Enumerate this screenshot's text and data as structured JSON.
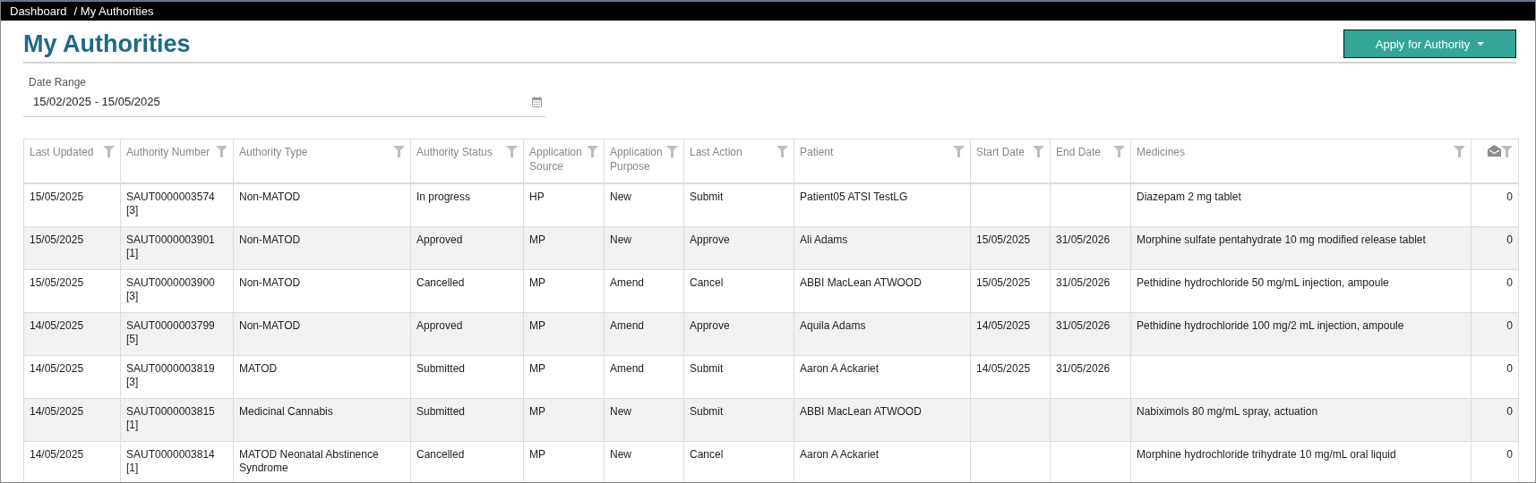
{
  "breadcrumb": [
    {
      "label": "Dashboard"
    },
    {
      "label": "/ My Authorities"
    }
  ],
  "title": "My Authorities",
  "apply_button": {
    "label": "Apply for Authority"
  },
  "date_range": {
    "label": "Date Range",
    "value": "15/02/2025 - 15/05/2025"
  },
  "table": {
    "columns": [
      {
        "label": "Last Updated"
      },
      {
        "label": "Authority Number"
      },
      {
        "label": "Authority Type"
      },
      {
        "label": "Authority Status"
      },
      {
        "label": "Application Source"
      },
      {
        "label": "Application Purpose"
      },
      {
        "label": "Last Action"
      },
      {
        "label": "Patient"
      },
      {
        "label": "Start Date"
      },
      {
        "label": "End Date"
      },
      {
        "label": "Medicines"
      },
      {
        "kind": "messages"
      }
    ],
    "rows": [
      {
        "last_updated": "15/05/2025",
        "authority_number": "SAUT0000003574",
        "version": "[3]",
        "authority_type": "Non-MATOD",
        "status": "In progress",
        "source": "HP",
        "purpose": "New",
        "last_action": "Submit",
        "patient": "Patient05 ATSI TestLG",
        "start_date": "",
        "end_date": "",
        "medicines": "Diazepam 2 mg tablet",
        "messages": "0"
      },
      {
        "last_updated": "15/05/2025",
        "authority_number": "SAUT0000003901",
        "version": "[1]",
        "authority_type": "Non-MATOD",
        "status": "Approved",
        "source": "MP",
        "purpose": "New",
        "last_action": "Approve",
        "patient": "Ali Adams",
        "start_date": "15/05/2025",
        "end_date": "31/05/2026",
        "medicines": "Morphine sulfate pentahydrate 10 mg modified release tablet",
        "messages": "0"
      },
      {
        "last_updated": "15/05/2025",
        "authority_number": "SAUT0000003900",
        "version": "[3]",
        "authority_type": "Non-MATOD",
        "status": "Cancelled",
        "source": "MP",
        "purpose": "Amend",
        "last_action": "Cancel",
        "patient": "ABBI MacLean ATWOOD",
        "start_date": "15/05/2025",
        "end_date": "31/05/2026",
        "medicines": "Pethidine hydrochloride 50 mg/mL injection, ampoule",
        "messages": "0"
      },
      {
        "last_updated": "14/05/2025",
        "authority_number": "SAUT0000003799",
        "version": "[5]",
        "authority_type": "Non-MATOD",
        "status": "Approved",
        "source": "MP",
        "purpose": "Amend",
        "last_action": "Approve",
        "patient": "Aquila Adams",
        "start_date": "14/05/2025",
        "end_date": "31/05/2026",
        "medicines": "Pethidine hydrochloride 100 mg/2 mL injection, ampoule",
        "messages": "0"
      },
      {
        "last_updated": "14/05/2025",
        "authority_number": "SAUT0000003819",
        "version": "[3]",
        "authority_type": "MATOD",
        "status": "Submitted",
        "source": "MP",
        "purpose": "Amend",
        "last_action": "Submit",
        "patient": "Aaron A Ackariet",
        "start_date": "14/05/2025",
        "end_date": "31/05/2026",
        "medicines": "",
        "messages": "0"
      },
      {
        "last_updated": "14/05/2025",
        "authority_number": "SAUT0000003815",
        "version": "[1]",
        "authority_type": "Medicinal Cannabis",
        "status": "Submitted",
        "source": "MP",
        "purpose": "New",
        "last_action": "Submit",
        "patient": "ABBI MacLean ATWOOD",
        "start_date": "",
        "end_date": "",
        "medicines": "Nabiximols 80 mg/mL spray, actuation",
        "messages": "0"
      },
      {
        "last_updated": "14/05/2025",
        "authority_number": "SAUT0000003814",
        "version": "[1]",
        "authority_type": "MATOD Neonatal Abstinence Syndrome",
        "status": "Cancelled",
        "source": "MP",
        "purpose": "New",
        "last_action": "Cancel",
        "patient": "Aaron A Ackariet",
        "start_date": "",
        "end_date": "",
        "medicines": "Morphine hydrochloride trihydrate 10 mg/mL oral liquid",
        "messages": "0"
      }
    ]
  }
}
